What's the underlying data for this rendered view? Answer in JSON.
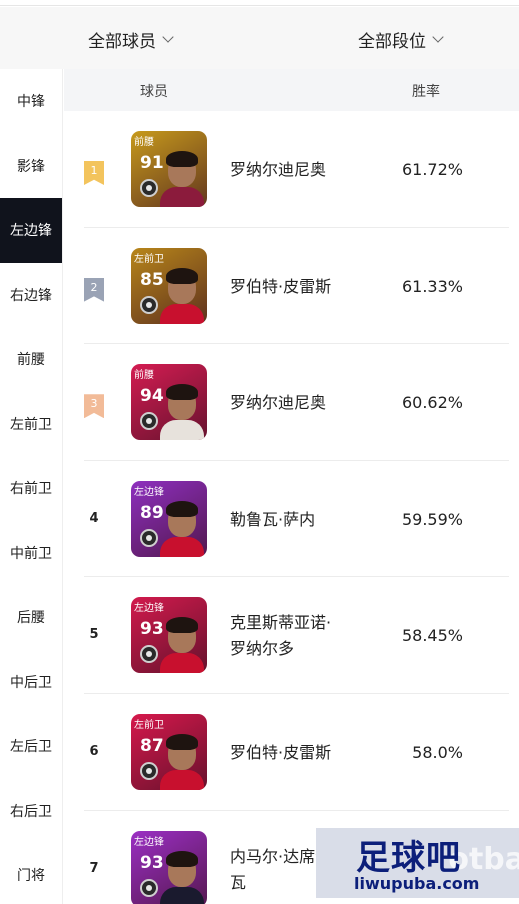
{
  "filters": {
    "players": "全部球员",
    "tier": "全部段位"
  },
  "sidebar": {
    "active": 2,
    "items": [
      "中锋",
      "影锋",
      "左边锋",
      "右边锋",
      "前腰",
      "左前卫",
      "右前卫",
      "中前卫",
      "后腰",
      "中后卫",
      "左后卫",
      "右后卫",
      "门将"
    ]
  },
  "table": {
    "col_player": "球员",
    "col_winrate": "胜率",
    "rows": [
      {
        "rank": "1",
        "ribbon": "gold",
        "position": "前腰",
        "rating": "91",
        "name": "罗纳尔迪尼奥",
        "name2": "",
        "winrate": "61.72%",
        "card_color": "#c79a1c",
        "shirt_color": "#8b1b3c"
      },
      {
        "rank": "2",
        "ribbon": "silver",
        "position": "左前卫",
        "rating": "85",
        "name": "罗伯特·皮雷斯",
        "name2": "",
        "winrate": "61.33%",
        "card_color": "#b8861a",
        "shirt_color": "#c8102e"
      },
      {
        "rank": "3",
        "ribbon": "bronze",
        "position": "前腰",
        "rating": "94",
        "name": "罗纳尔迪尼奥",
        "name2": "",
        "winrate": "60.62%",
        "card_color": "#d41c52",
        "shirt_color": "#e7e2dc"
      },
      {
        "rank": "4",
        "ribbon": "",
        "position": "左边锋",
        "rating": "89",
        "name": "勒鲁瓦·萨内",
        "name2": "",
        "winrate": "59.59%",
        "card_color": "#8e2fbf",
        "shirt_color": "#c8102e"
      },
      {
        "rank": "5",
        "ribbon": "",
        "position": "左边锋",
        "rating": "93",
        "name": "克里斯蒂亚诺·",
        "name2": "罗纳尔多",
        "winrate": "58.45%",
        "card_color": "#d21a4d",
        "shirt_color": "#c8102e"
      },
      {
        "rank": "6",
        "ribbon": "",
        "position": "左前卫",
        "rating": "87",
        "name": "罗伯特·皮雷斯",
        "name2": "",
        "winrate": "58.0%",
        "card_color": "#d6184c",
        "shirt_color": "#c8102e"
      },
      {
        "rank": "7",
        "ribbon": "",
        "position": "左边锋",
        "rating": "93",
        "name": "内马尔·达席尔",
        "name2": "瓦",
        "winrate": "",
        "card_color": "#9b2fc4",
        "shirt_color": "#1a1a2e"
      }
    ]
  },
  "watermark": {
    "logo": "足球吧",
    "url": "liwupuba.com",
    "bg_text": "otba"
  },
  "colors": {
    "sidebar_active_bg": "#10131c",
    "header_bg": "#f4f5f7",
    "filter_bg": "#f7f7f7"
  }
}
